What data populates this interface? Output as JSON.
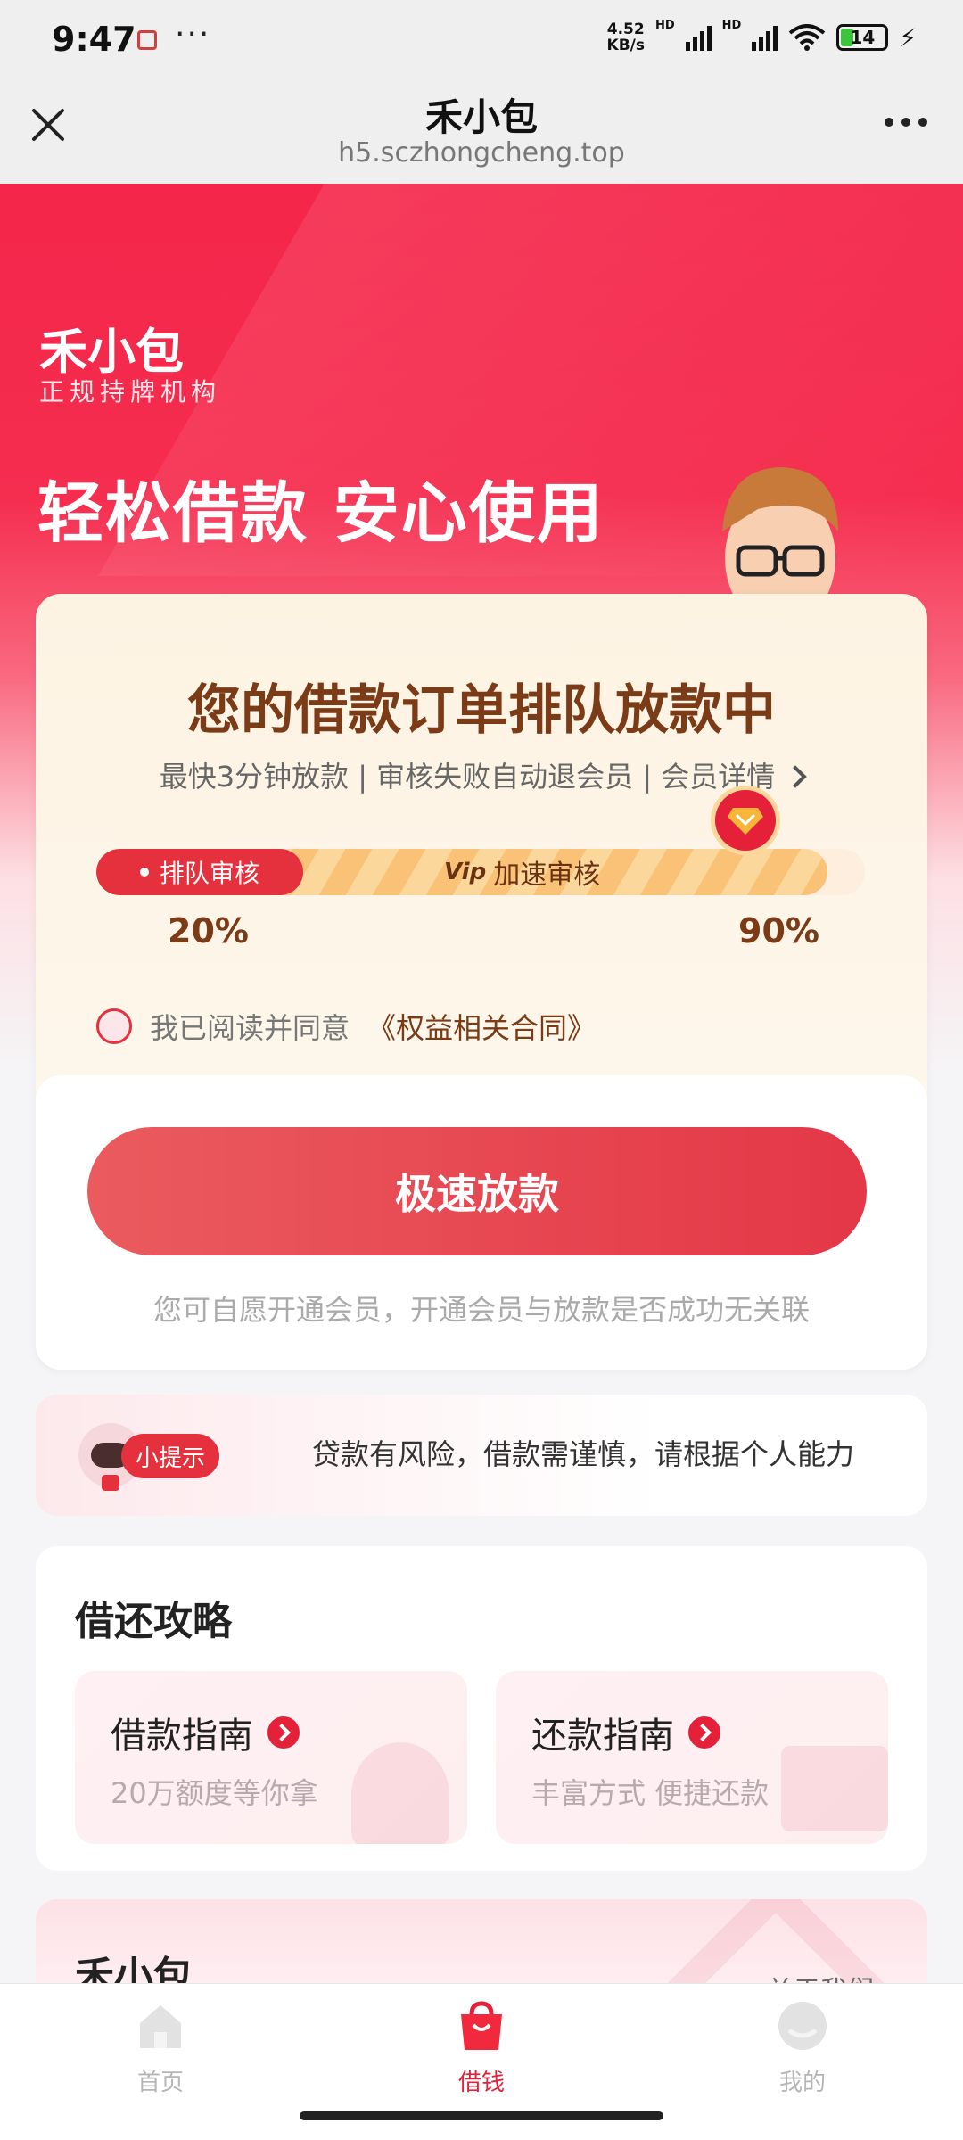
{
  "status_bar": {
    "time": "9:47",
    "more": "···",
    "net_speed_value": "4.52",
    "net_speed_unit": "KB/s",
    "hd1": "HD",
    "hd2": "HD",
    "battery": "14"
  },
  "nav": {
    "title": "禾小包",
    "url": "h5.sczhongcheng.top"
  },
  "hero": {
    "brand": "禾小包",
    "brand_sub": "正规持牌机构",
    "slogan": "轻松借款 安心使用"
  },
  "order": {
    "title": "您的借款订单排队放款中",
    "subtitle": "最快3分钟放款 | 审核失败自动退会员 | 会员详情",
    "progress": {
      "left_label": "排队审核",
      "mid_vip": "Vip",
      "mid_label": "加速审核",
      "left_percent": "20%",
      "right_percent": "90%",
      "fill_fraction": 0.9
    },
    "agree_text": "我已阅读并同意",
    "agree_link": "《权益相关合同》",
    "button_label": "极速放款",
    "note": "您可自愿开通会员，开通会员与放款是否成功无关联"
  },
  "tip": {
    "tag": "小提示",
    "text": "贷款有风险，借款需谨慎，请根据个人能力"
  },
  "guide": {
    "title": "借还攻略",
    "items": [
      {
        "title": "借款指南",
        "subtitle": "20万额度等你拿"
      },
      {
        "title": "还款指南",
        "subtitle": "丰富方式 便捷还款"
      }
    ]
  },
  "about": {
    "title": "禾小包",
    "more": "关于我们"
  },
  "tabbar": {
    "items": [
      {
        "label": "首页",
        "active": false
      },
      {
        "label": "借钱",
        "active": true
      },
      {
        "label": "我的",
        "active": false
      }
    ]
  },
  "colors": {
    "brand_red": "#e5213a",
    "order_title_brown": "#7a3b16",
    "button_red": "#e43747"
  }
}
